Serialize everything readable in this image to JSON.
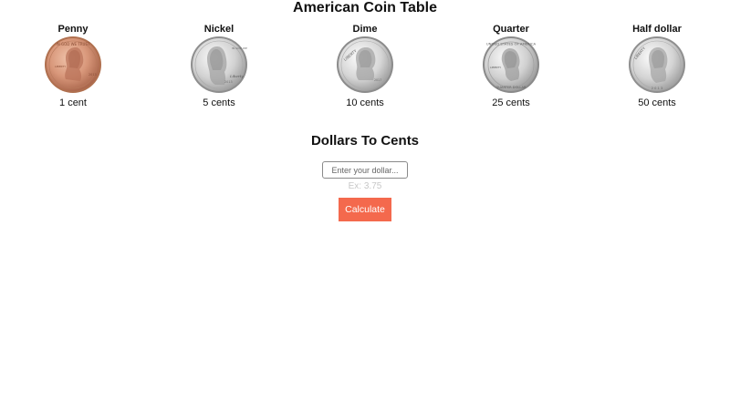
{
  "header": {
    "title": "American Coin Table"
  },
  "coins": [
    {
      "name": "Penny",
      "value": "1 cent"
    },
    {
      "name": "Nickel",
      "value": "5 cents"
    },
    {
      "name": "Dime",
      "value": "10 cents"
    },
    {
      "name": "Quarter",
      "value": "25 cents"
    },
    {
      "name": "Half dollar",
      "value": "50 cents"
    }
  ],
  "converter": {
    "title": "Dollars To Cents",
    "input_placeholder": "Enter your dollar...",
    "input_value": "",
    "example": "Ex: 3.75",
    "button_label": "Calculate"
  },
  "colors": {
    "button_bg": "#f4694d",
    "penny": "#c98a6c",
    "silver": "#d4d4d4"
  }
}
